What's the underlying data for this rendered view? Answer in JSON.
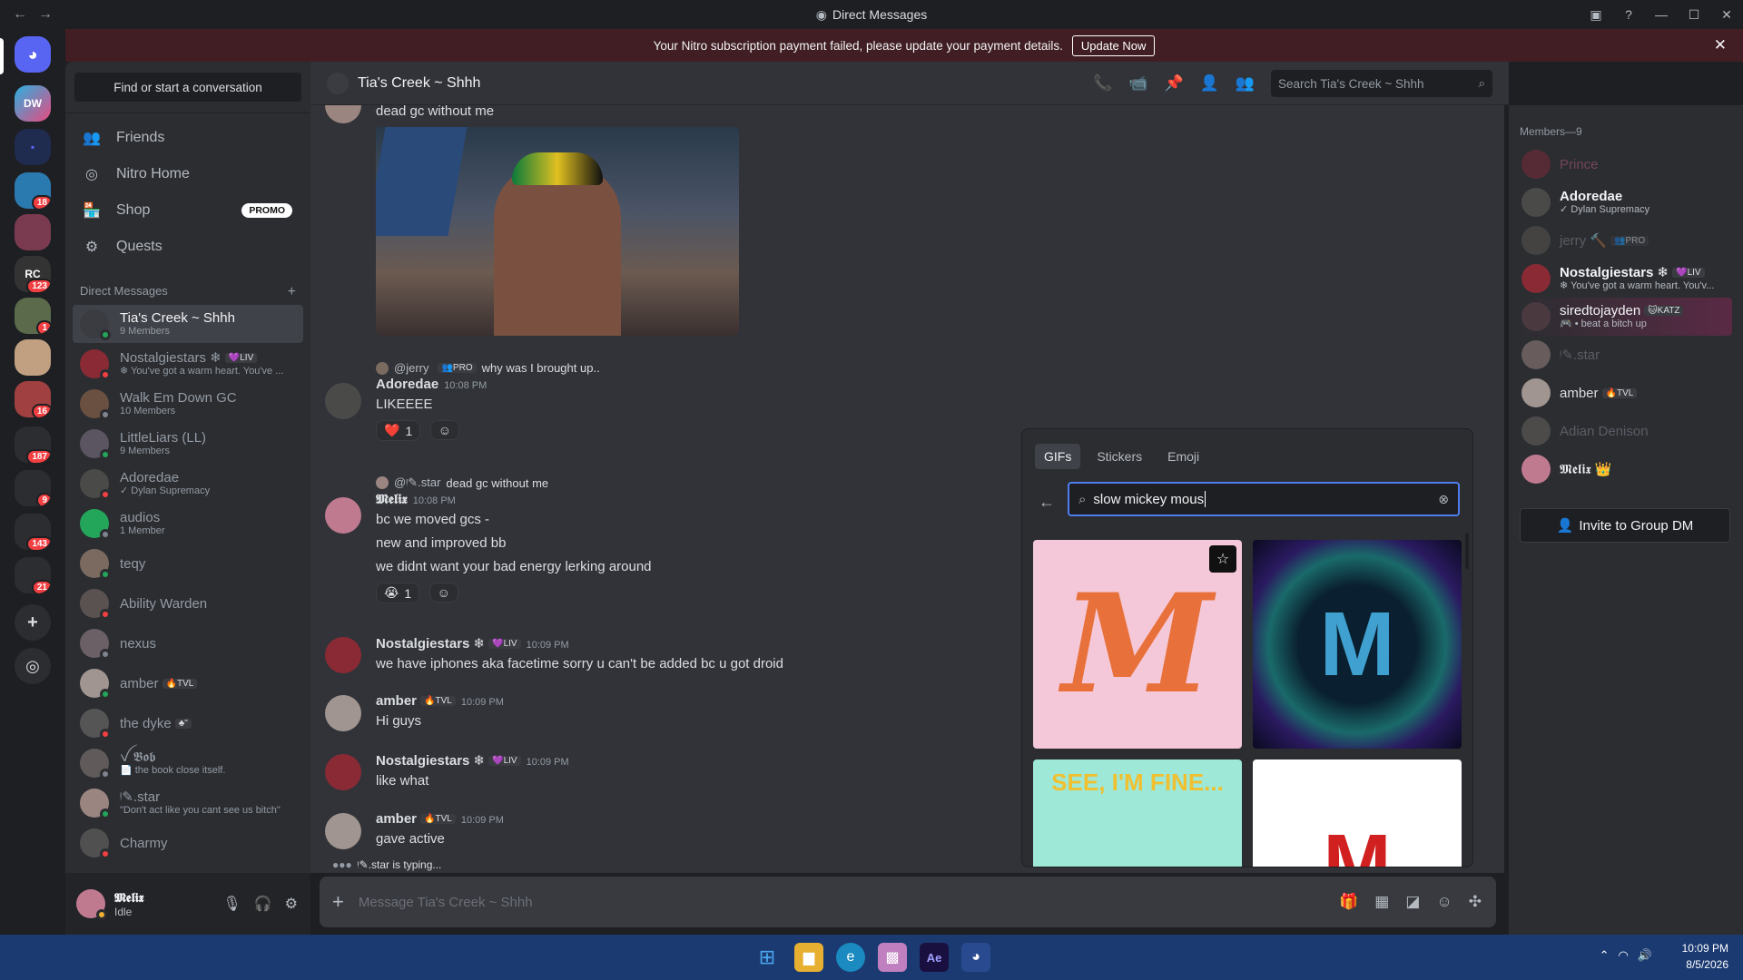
{
  "window": {
    "title": "Direct Messages",
    "nav_back": "←",
    "nav_fwd": "→",
    "controls": [
      "▣",
      "?",
      "—",
      "☐",
      "✕"
    ]
  },
  "banner": {
    "text": "Your Nitro subscription payment failed, please update your payment details.",
    "button": "Update Now",
    "close": "✕"
  },
  "servers": [
    {
      "badge": ""
    },
    {
      "badge": ""
    },
    {
      "badge": ""
    },
    {
      "badge": "18"
    },
    {
      "badge": ""
    },
    {
      "badge": "123"
    },
    {
      "badge": "1"
    },
    {
      "badge": ""
    },
    {
      "badge": "16"
    },
    {
      "badge": "187"
    },
    {
      "badge": "9"
    },
    {
      "badge": "143"
    },
    {
      "badge": "21"
    }
  ],
  "sidebar": {
    "find": "Find or start a conversation",
    "nav": [
      {
        "label": "Friends",
        "icon": "👥"
      },
      {
        "label": "Nitro Home",
        "icon": "◎"
      },
      {
        "label": "Shop",
        "icon": "🏪",
        "promo": "PROMO"
      },
      {
        "label": "Quests",
        "icon": "⚙"
      }
    ],
    "dm_header": "Direct Messages",
    "dm_add": "+",
    "dms": [
      {
        "name": "Tia's Creek ~ Shhh",
        "sub": "9 Members",
        "tag": "",
        "color": "#3a3c42"
      },
      {
        "name": "Nostalgiestars ❄",
        "sub": "❄ You've got a warm heart. You've ...",
        "tag": "💜LIV",
        "color": "#8a2a35"
      },
      {
        "name": "Walk Em Down GC",
        "sub": "10 Members",
        "tag": "",
        "color": "#6a5040"
      },
      {
        "name": "LittleLiars (LL)",
        "sub": "9 Members",
        "tag": "",
        "color": "#5a5560"
      },
      {
        "name": "Adoredae",
        "sub": "✓ Dylan Supremacy",
        "tag": "",
        "color": "#4a4a48"
      },
      {
        "name": "audios",
        "sub": "1 Member",
        "tag": "",
        "color": "#23a55a"
      },
      {
        "name": "teqy",
        "sub": "",
        "tag": "",
        "color": "#7a6a60"
      },
      {
        "name": "Ability Warden",
        "sub": "",
        "tag": "",
        "color": "#5a5250"
      },
      {
        "name": "nexus",
        "sub": "",
        "tag": "",
        "color": "#6a6065"
      },
      {
        "name": "amber",
        "sub": "",
        "tag": "🔥TVL",
        "color": "#a09590"
      },
      {
        "name": "the dyke",
        "sub": "",
        "tag": "♣\"",
        "color": "#555"
      },
      {
        "name": "ꪜ 𝕭𝖔𝖇",
        "sub": "📄 the book close itself.",
        "tag": "",
        "color": "#605a5a"
      },
      {
        "name": "ᵎ✎.star",
        "sub": "\"Don't act like you cant see us bitch\"",
        "tag": "",
        "color": "#9a8580"
      },
      {
        "name": "Charmy",
        "sub": "",
        "tag": "",
        "color": "#505050"
      }
    ]
  },
  "user": {
    "name": "𝕸𝖊𝖑𝖎𝖝",
    "status": "Idle"
  },
  "chat": {
    "channel": "Tia's Creek ~ Shhh",
    "search": "Search Tia's Creek ~ Shhh",
    "composer_placeholder": "Message Tia's Creek ~ Shhh",
    "typing": "ᵎ✎.star is typing...",
    "messages": [
      {
        "text": "dead gc without me"
      },
      {
        "reply_user": "@jerry",
        "reply_tag": "👥PRO",
        "reply_text": "why was I brought up..",
        "user": "Adoredae",
        "time": "10:08 PM",
        "text": "LIKEEEE",
        "reaction": "❤️",
        "reaction_count": "1",
        "user_color": "#f2f3f5"
      },
      {
        "reply_user": "@ᵎ✎.star",
        "reply_text": "dead gc without me",
        "user": "𝕸𝖊𝖑𝖎𝖝",
        "time": "10:08 PM",
        "lines": [
          "bc we moved gcs -",
          "new and improved bb",
          "we didnt want your bad energy lerking around"
        ],
        "reaction": "😭",
        "reaction_count": "1",
        "user_color": "#f2f3f5"
      },
      {
        "user": "Nostalgiestars ❄",
        "tag": "💜LIV",
        "time": "10:09 PM",
        "text": "we have iphones aka facetime sorry u can't be added bc u got droid",
        "user_color": "#f2f3f5"
      },
      {
        "user": "amber",
        "tag": "🔥TVL",
        "time": "10:09 PM",
        "text": "Hi guys",
        "user_color": "#f2f3f5"
      },
      {
        "user": "Nostalgiestars ❄",
        "tag": "💜LIV",
        "time": "10:09 PM",
        "text": "like what",
        "user_color": "#f2f3f5"
      },
      {
        "user": "amber",
        "tag": "🔥TVL",
        "time": "10:09 PM",
        "text": "gave active",
        "user_color": "#f2f3f5"
      }
    ]
  },
  "members": {
    "header": "Members—9",
    "invite": "Invite to Group DM",
    "list": [
      {
        "name": "Prince",
        "sub": "",
        "tag": "",
        "color": "#7a2a3a",
        "name_color": "#b05a78",
        "dim": true
      },
      {
        "name": "Adoredae",
        "sub": "✓ Dylan Supremacy",
        "tag": "",
        "color": "#4a4a48",
        "name_color": "#f2f3f5",
        "dim": false
      },
      {
        "name": "jerry 🔨",
        "sub": "",
        "tag": "👥PRO",
        "color": "#5a5550",
        "name_color": "#80848e",
        "dim": true
      },
      {
        "name": "Nostalgiestars ❄",
        "sub": "❄ You've got a warm heart. You'v...",
        "tag": "💜LIV",
        "color": "#8a2a35",
        "name_color": "#f2f3f5",
        "dim": false
      },
      {
        "name": "siredtojayden",
        "sub": "🎮 • beat a bitch up",
        "tag": "🐱KATZ",
        "color": "#4a3a40",
        "name_color": "#f2f3f5",
        "dim": false
      },
      {
        "name": "ᵎ✎.star",
        "sub": "",
        "tag": "",
        "color": "#9a8580",
        "name_color": "#80848e",
        "dim": true
      },
      {
        "name": "amber",
        "sub": "",
        "tag": "🔥TVL",
        "color": "#a09590",
        "name_color": "#dbdee1",
        "dim": false
      },
      {
        "name": "Adian Denison",
        "sub": "",
        "tag": "",
        "color": "#6a6560",
        "name_color": "#80848e",
        "dim": true
      },
      {
        "name": "𝕸𝖊𝖑𝖎𝖝 👑",
        "sub": "",
        "tag": "",
        "color": "#c07a90",
        "name_color": "#f2f3f5",
        "dim": false
      }
    ]
  },
  "picker": {
    "tabs": [
      "GIFs",
      "Stickers",
      "Emoji"
    ],
    "active_tab": "GIFs",
    "query": "slow mickey mous",
    "gif_texts": [
      "M",
      "M",
      "SEE, I'M FINE...",
      "M"
    ]
  },
  "taskbar": {
    "time": "10:09 PM",
    "date": "8/5/2026"
  }
}
